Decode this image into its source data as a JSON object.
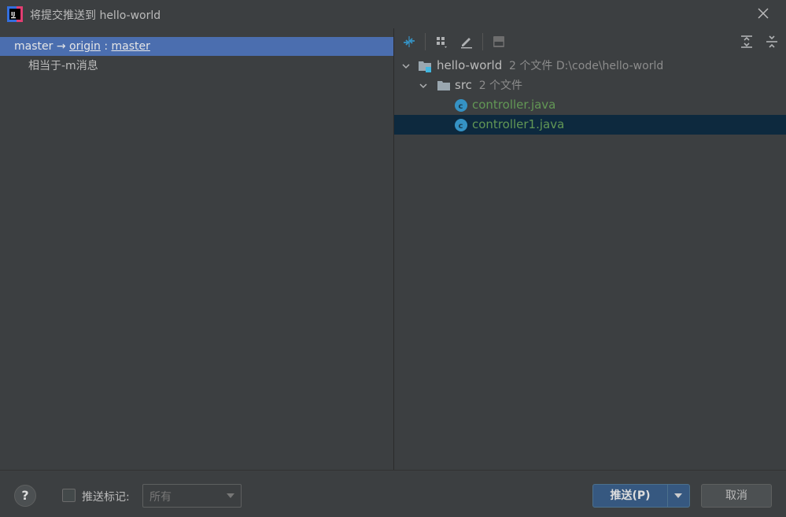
{
  "window": {
    "title": "将提交推送到 hello-world"
  },
  "commits": {
    "branch_row": {
      "local": "master",
      "arrow": "→",
      "remote": "origin",
      "sep": ":",
      "remote_branch": "master"
    },
    "message": "相当于-m消息"
  },
  "tree": {
    "root": {
      "label": "hello-world",
      "meta": "2 个文件  D:\\code\\hello-world",
      "icon": "module-folder-icon"
    },
    "folder": {
      "label": "src",
      "meta": "2 个文件",
      "icon": "folder-icon"
    },
    "files": [
      {
        "label": "controller.java",
        "icon": "java-class-icon",
        "selected": false
      },
      {
        "label": "controller1.java",
        "icon": "java-class-icon",
        "selected": true
      }
    ]
  },
  "footer": {
    "help": "?",
    "checkbox_label": "推送标记:",
    "select_value": "所有",
    "push_label": "推送(P)",
    "cancel_label": "取消"
  },
  "colors": {
    "accent": "#4b6eaf",
    "selection": "#0d293e",
    "primary_button": "#365880",
    "file_added": "#629755",
    "java_icon": "#3592c4"
  }
}
